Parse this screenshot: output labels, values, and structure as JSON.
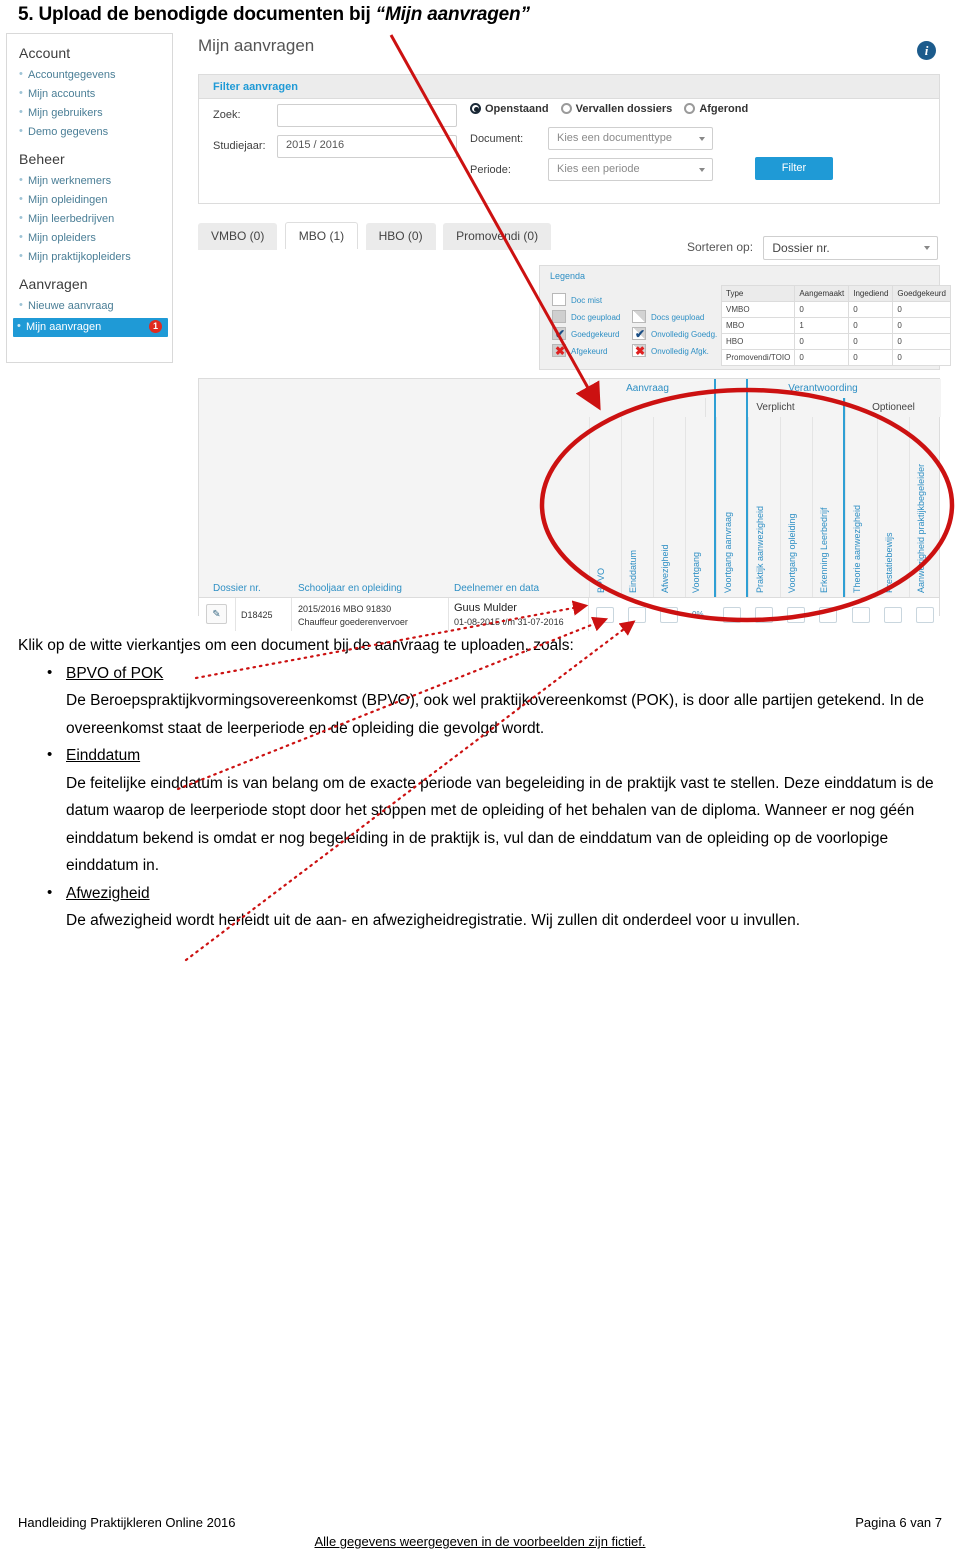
{
  "heading": {
    "prefix": "5. Upload de benodigde documenten bij ",
    "quoted": "“Mijn aanvragen”"
  },
  "app": {
    "sidebar": {
      "groups": [
        {
          "title": "Account",
          "items": [
            {
              "label": "Accountgegevens"
            },
            {
              "label": "Mijn accounts"
            },
            {
              "label": "Mijn gebruikers"
            },
            {
              "label": "Demo gegevens"
            }
          ]
        },
        {
          "title": "Beheer",
          "items": [
            {
              "label": "Mijn werknemers"
            },
            {
              "label": "Mijn opleidingen"
            },
            {
              "label": "Mijn leerbedrijven"
            },
            {
              "label": "Mijn opleiders"
            },
            {
              "label": "Mijn praktijkopleiders"
            }
          ]
        },
        {
          "title": "Aanvragen",
          "items": [
            {
              "label": "Nieuwe aanvraag"
            },
            {
              "label": "Mijn aanvragen",
              "active": true,
              "badge": "1"
            }
          ]
        }
      ]
    },
    "page_title": "Mijn aanvragen",
    "info_icon_glyph": "i",
    "filter": {
      "bar_label": "Filter aanvragen",
      "zoek_label": "Zoek:",
      "zoek_value": "",
      "studiejaar_label": "Studiejaar:",
      "studiejaar_value": "2015 / 2016",
      "radios": [
        {
          "label": "Openstaand",
          "selected": true
        },
        {
          "label": "Vervallen dossiers",
          "selected": false
        },
        {
          "label": "Afgerond",
          "selected": false
        }
      ],
      "document_label": "Document:",
      "document_value": "Kies een documenttype",
      "periode_label": "Periode:",
      "periode_value": "Kies een periode",
      "filter_button": "Filter"
    },
    "tabs": [
      {
        "label": "VMBO (0)",
        "active": false
      },
      {
        "label": "MBO (1)",
        "active": true
      },
      {
        "label": "HBO (0)",
        "active": false
      },
      {
        "label": "Promovendi (0)",
        "active": false
      }
    ],
    "sort": {
      "label": "Sorteren op:",
      "value": "Dossier nr."
    },
    "legend": {
      "title": "Legenda",
      "left": [
        {
          "label": "Doc mist",
          "style": "empty"
        },
        {
          "label": "Doc geupload",
          "style": "grey"
        },
        {
          "label": "Goedgekeurd",
          "style": "check-grey"
        },
        {
          "label": "Afgekeurd",
          "style": "cross-grey"
        }
      ],
      "right": [
        {
          "label": "Docs geupload",
          "style": "half"
        },
        {
          "label": "Onvolledig Goedg.",
          "style": "check-half"
        },
        {
          "label": "Onvolledig Afgk.",
          "style": "cross-half"
        }
      ]
    },
    "stats": {
      "headers": [
        "Type",
        "Aangemaakt",
        "Ingediend",
        "Goedgekeurd"
      ],
      "rows": [
        [
          "VMBO",
          "0",
          "0",
          "0"
        ],
        [
          "MBO",
          "1",
          "0",
          "0"
        ],
        [
          "HBO",
          "0",
          "0",
          "0"
        ],
        [
          "Promovendi/TOIO",
          "0",
          "0",
          "0"
        ]
      ]
    },
    "table": {
      "group_headers": [
        {
          "label": "Aanvraag"
        },
        {
          "label": "Verantwoording"
        }
      ],
      "sub_headers": [
        {
          "label": "Verplicht"
        },
        {
          "label": "Optioneel"
        }
      ],
      "left_headers": [
        "Dossier nr.",
        "Schooljaar en opleiding",
        "Deelnemer en data"
      ],
      "rotated_headers": [
        "BPVO",
        "Einddatum",
        "Afwezigheid",
        "Voortgang",
        "Voortgang aanvraag",
        "Praktijk aanwezigheid",
        "Voortgang opleiding",
        "Erkenning Leerbedrijf",
        "Theorie aanwezigheid",
        "Prestatiebewijs",
        "Aanwezigheid praktijkbegeleider"
      ],
      "row": {
        "edit_glyph": "✎",
        "dossier": "D18425",
        "schooljaar": "2015/2016 MBO 91830",
        "opleiding": "Chauffeur goederenvervoer",
        "deelnemer": "Guus  Mulder",
        "data": "01-08-2015 t/m 31-07-2016",
        "voortgang": "0%"
      }
    }
  },
  "content": {
    "lead": "Klik op de witte vierkantjes om een document bij de aanvraag te uploaden, zoals:",
    "bullets": [
      {
        "title": "BPVO of POK",
        "body": "De Beroepspraktijkvormingsovereenkomst (BPVO), ook wel praktijkovereenkomst (POK), is door alle partijen getekend. In de overeenkomst staat de leerperiode en de opleiding die gevolgd wordt."
      },
      {
        "title": "Einddatum",
        "body": "De feitelijke einddatum is van belang om de exacte periode van begeleiding in de praktijk vast te stellen. Deze einddatum is de datum waarop de leerperiode stopt door het stoppen met de opleiding of het behalen van de diploma. Wanneer er nog géén einddatum bekend is omdat er nog begeleiding in de praktijk is, vul dan de einddatum van de opleiding op de voorlopige einddatum in."
      },
      {
        "title": "Afwezigheid",
        "body": "De afwezigheid wordt herleidt uit de aan- en afwezigheidregistratie. Wij zullen dit onderdeel voor u invullen."
      }
    ]
  },
  "footer": {
    "left": "Handleiding Praktijkleren Online 2016",
    "right": "Pagina 6 van 7",
    "center": "Alle gegevens weergegeven in de voorbeelden zijn fictief."
  },
  "colors": {
    "accent_blue": "#1f9ad6",
    "link_blue": "#2e8fc4",
    "annotation_red": "#cc1111",
    "badge_red": "#e02b20"
  }
}
